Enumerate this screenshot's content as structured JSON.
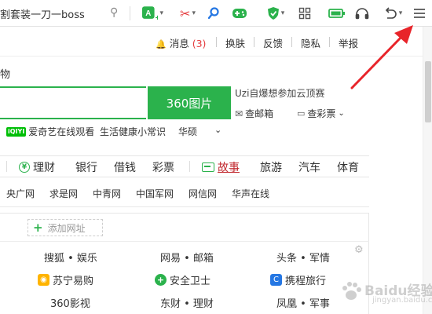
{
  "toolbar": {
    "tab_title": "割套装一刀一boss",
    "icons": [
      "search-icon",
      "app-plus-icon",
      "scissors-icon",
      "magnifier-icon",
      "gamepad-icon",
      "shield-icon",
      "grid-icon",
      "battery-icon",
      "headphones-icon",
      "undo-icon",
      "menu-icon"
    ],
    "accent": "#2bb24c"
  },
  "infobar": {
    "messages_label": "消息",
    "messages_count": "(3)",
    "skin": "换肤",
    "feedback": "反馈",
    "privacy": "隐私",
    "report": "举报"
  },
  "search": {
    "partial_label": "物",
    "button": "360图片",
    "promo": "Uzi自爆想参加云顶赛",
    "mail": "查邮箱",
    "lottery": "查彩票"
  },
  "quick_links": {
    "iqiyi_badge": "iQIYI",
    "iqiyi": "爱奇艺在线观看",
    "life": "生活健康小常识",
    "huashuo": "华硕"
  },
  "categories": {
    "finance": "理财",
    "bank": "银行",
    "loan": "借钱",
    "lottery": "彩票",
    "story": "故事",
    "travel": "旅游",
    "car": "汽车",
    "sports": "体育"
  },
  "sites": [
    "央广网",
    "求是网",
    "中青网",
    "中国军网",
    "网信网",
    "华声在线"
  ],
  "panel": {
    "add_link": "添加网址",
    "entries": [
      {
        "label": "搜狐 • 娱乐"
      },
      {
        "label": "网易 • 邮箱"
      },
      {
        "label": "头条 • 军情"
      },
      {
        "label": "苏宁易购"
      },
      {
        "label": "安全卫士"
      },
      {
        "label": "携程旅行"
      },
      {
        "label": "360影视"
      },
      {
        "label": "东财 • 理财"
      },
      {
        "label": "凤凰 • 军事"
      }
    ]
  },
  "annotation_color": "#e8242a",
  "watermark": {
    "main": "Baidu经验",
    "sub": "jingyan.baidu.com"
  }
}
